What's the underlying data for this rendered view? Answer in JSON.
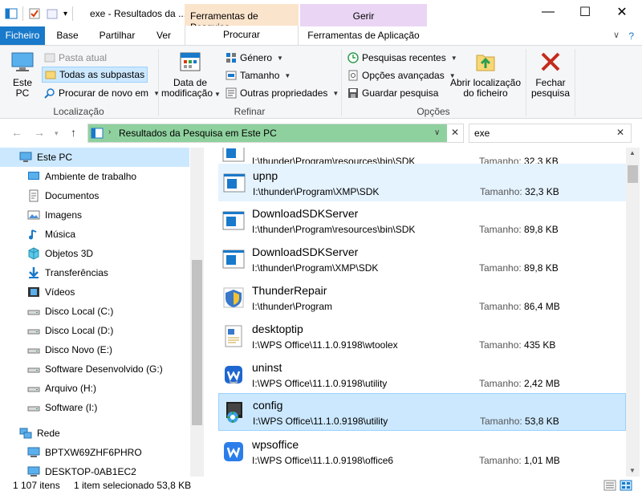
{
  "window": {
    "title": "exe - Resultados da ...",
    "context_tab_search": "Ferramentas de Pesquisa",
    "context_tab_manage": "Gerir",
    "minimize_glyph": "—",
    "maximize_glyph": "☐",
    "close_glyph": "✕"
  },
  "tabs": {
    "file": "Ficheiro",
    "home": "Base",
    "share": "Partilhar",
    "view": "Ver",
    "search": "Procurar",
    "app_tools": "Ferramentas de Aplicação",
    "help_glyph": "?",
    "collapse_glyph": "∨"
  },
  "ribbon": {
    "location": {
      "current_folder": "Pasta atual",
      "all_subfolders": "Todas as subpastas",
      "search_again_in": "Procurar de novo em",
      "this_pc_line1": "Este",
      "this_pc_line2": "PC",
      "label": "Localização"
    },
    "refine": {
      "date_modified_line1": "Data de",
      "date_modified_line2": "modificação",
      "kind": "Género",
      "size": "Tamanho",
      "other_properties": "Outras propriedades",
      "label": "Refinar"
    },
    "options": {
      "recent_searches": "Pesquisas recentes",
      "advanced_options": "Opções avançadas",
      "save_search": "Guardar pesquisa",
      "open_location_line1": "Abrir localização",
      "open_location_line2": "do ficheiro",
      "label": "Opções"
    },
    "close_search_line1": "Fechar",
    "close_search_line2": "pesquisa"
  },
  "address": {
    "path": "Resultados da Pesquisa em Este PC",
    "search_value": "exe"
  },
  "nav_pane": {
    "items": [
      {
        "label": "Este PC",
        "icon": "monitor-icon",
        "level": 0
      },
      {
        "label": "Ambiente de trabalho",
        "icon": "desktop-icon",
        "level": 1
      },
      {
        "label": "Documentos",
        "icon": "documents-icon",
        "level": 1
      },
      {
        "label": "Imagens",
        "icon": "pictures-icon",
        "level": 1
      },
      {
        "label": "Música",
        "icon": "music-icon",
        "level": 1
      },
      {
        "label": "Objetos 3D",
        "icon": "cube-icon",
        "level": 1
      },
      {
        "label": "Transferências",
        "icon": "download-icon",
        "level": 1
      },
      {
        "label": "Vídeos",
        "icon": "video-icon",
        "level": 1
      },
      {
        "label": "Disco Local (C:)",
        "icon": "drive-icon",
        "level": 1
      },
      {
        "label": "Disco Local (D:)",
        "icon": "drive-icon",
        "level": 1
      },
      {
        "label": "Disco Novo (E:)",
        "icon": "drive-icon",
        "level": 1
      },
      {
        "label": "Software Desenvolvido (G:)",
        "icon": "drive-icon",
        "level": 1
      },
      {
        "label": "Arquivo (H:)",
        "icon": "drive-icon",
        "level": 1
      },
      {
        "label": "Software (I:)",
        "icon": "drive-icon",
        "level": 1
      },
      {
        "label": "Rede",
        "icon": "network-icon",
        "level": 0
      },
      {
        "label": "BPTXW69ZHF6PHRO",
        "icon": "computer-icon",
        "level": 1
      },
      {
        "label": "DESKTOP-0AB1EC2",
        "icon": "computer-icon",
        "level": 1
      }
    ]
  },
  "files": {
    "size_label": "Tamanho:",
    "items": [
      {
        "name": "",
        "path": "I:\\thunder\\Program\\resources\\bin\\SDK",
        "size": "32,3 KB",
        "icon": "app-window-icon"
      },
      {
        "name": "upnp",
        "path": "I:\\thunder\\Program\\XMP\\SDK",
        "size": "32,3 KB",
        "icon": "app-window-icon"
      },
      {
        "name": "DownloadSDKServer",
        "path": "I:\\thunder\\Program\\resources\\bin\\SDK",
        "size": "89,8 KB",
        "icon": "app-window-icon"
      },
      {
        "name": "DownloadSDKServer",
        "path": "I:\\thunder\\Program\\XMP\\SDK",
        "size": "89,8 KB",
        "icon": "app-window-icon"
      },
      {
        "name": "ThunderRepair",
        "path": "I:\\thunder\\Program",
        "size": "86,4 MB",
        "icon": "thunder-repair-icon"
      },
      {
        "name": "desktoptip",
        "path": "I:\\WPS Office\\11.1.0.9198\\wtoolex",
        "size": "435 KB",
        "icon": "wps-doc-icon"
      },
      {
        "name": "uninst",
        "path": "I:\\WPS Office\\11.1.0.9198\\utility",
        "size": "2,42 MB",
        "icon": "wps-uninstall-icon"
      },
      {
        "name": "config",
        "path": "I:\\WPS Office\\11.1.0.9198\\utility",
        "size": "53,8 KB",
        "icon": "config-icon"
      },
      {
        "name": "wpsoffice",
        "path": "I:\\WPS Office\\11.1.0.9198\\office6",
        "size": "1,01 MB",
        "icon": "wps-office-icon"
      }
    ]
  },
  "status": {
    "item_count": "1 107 itens",
    "selection": "1 item selecionado 53,8 KB"
  },
  "colors": {
    "accent": "#1979ca",
    "selection": "#cce8ff",
    "search_context": "#fbe4cc",
    "manage_context": "#ead5f5",
    "address_highlight": "#8fd19e"
  }
}
